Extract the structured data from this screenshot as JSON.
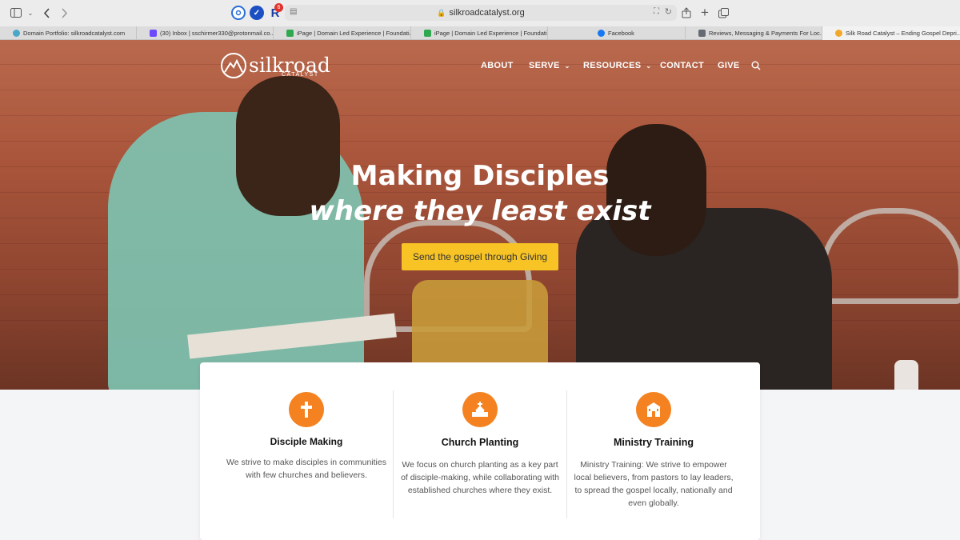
{
  "browser": {
    "url": "silkroadcatalyst.org",
    "extension_badge": "6",
    "tabs": [
      {
        "title": "Domain Portfolio: silkroadcatalyst.com",
        "color": "#4aa7c8"
      },
      {
        "title": "(30) Inbox | sschirmer330@protonmail.co...",
        "color": "#6d4aff"
      },
      {
        "title": "iPage | Domain Led Experience | Foundati...",
        "color": "#2fa84f"
      },
      {
        "title": "iPage | Domain Led Experience | Foundati...",
        "color": "#2fa84f"
      },
      {
        "title": "Facebook",
        "color": "#1877f2"
      },
      {
        "title": "Reviews, Messaging & Payments For Loc...",
        "color": "#666a73"
      },
      {
        "title": "Silk Road Catalyst – Ending Gospel Depri...",
        "color": "#f1a92a"
      }
    ]
  },
  "site": {
    "logo_word": "silkroad",
    "logo_sub": "CATALYST",
    "nav": {
      "about": "ABOUT",
      "serve": "SERVE",
      "resources": "RESOURCES",
      "contact": "CONTACT",
      "give": "GIVE"
    },
    "hero": {
      "line1": "Making Disciples",
      "line2": "where they least exist",
      "cta": "Send the gospel through Giving"
    },
    "features": [
      {
        "icon": "cross-icon",
        "title": "Disciple Making",
        "text": "We strive to make disciples in communities with few churches and believers."
      },
      {
        "icon": "church-icon",
        "title": "Church Planting",
        "text": "We focus on church planting as a key part of disciple-making, while collaborating with established churches where they exist."
      },
      {
        "icon": "school-icon",
        "title": "Ministry Training",
        "text": "Ministry Training: We strive to empower local believers, from pastors to lay leaders, to spread the gospel locally, nationally and even globally."
      }
    ]
  },
  "colors": {
    "accent": "#f58220",
    "cta": "#f7c325"
  }
}
